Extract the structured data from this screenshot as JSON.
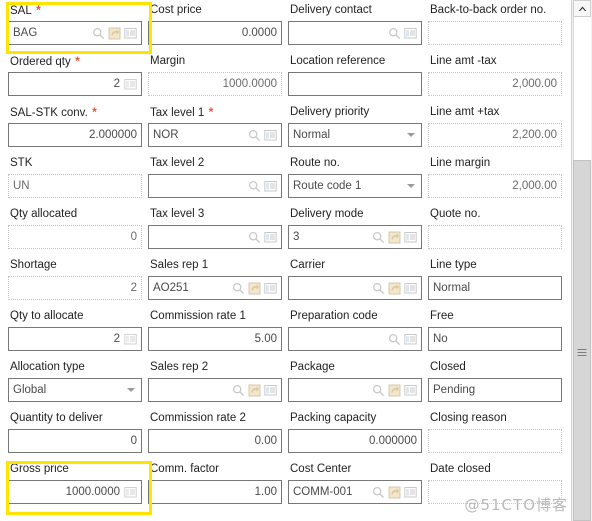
{
  "form": {
    "rows": [
      [
        {
          "label": "SAL",
          "required": true,
          "value": "BAG",
          "align": "left",
          "state": "enabled",
          "type": "lookup",
          "icons": [
            "search-icon",
            "lookup-icon",
            "list-icon"
          ],
          "name": "sal"
        },
        {
          "label": "Cost price",
          "required": false,
          "value": "0.0000",
          "align": "right",
          "state": "enabled",
          "type": "text",
          "icons": [],
          "name": "cost-price"
        },
        {
          "label": "Delivery contact",
          "required": false,
          "value": "",
          "align": "left",
          "state": "enabled",
          "type": "lookup",
          "icons": [
            "search-icon",
            "list-icon"
          ],
          "name": "delivery-contact"
        },
        {
          "label": "Back-to-back order no.",
          "required": false,
          "value": "",
          "align": "left",
          "state": "disabled",
          "type": "text",
          "icons": [],
          "name": "back-to-back-order-no"
        }
      ],
      [
        {
          "label": "Ordered qty",
          "required": true,
          "value": "2",
          "align": "right",
          "state": "enabled",
          "type": "calc",
          "icons": [
            "calculator-icon"
          ],
          "name": "ordered-qty"
        },
        {
          "label": "Margin",
          "required": false,
          "value": "1000.0000",
          "align": "right",
          "state": "disabled",
          "type": "text",
          "icons": [],
          "name": "margin"
        },
        {
          "label": "Location reference",
          "required": false,
          "value": "",
          "align": "left",
          "state": "enabled",
          "type": "text",
          "icons": [],
          "name": "location-reference"
        },
        {
          "label": "Line amt -tax",
          "required": false,
          "value": "2,000.00",
          "align": "right",
          "state": "disabled",
          "type": "text",
          "icons": [],
          "name": "line-amt-minus-tax"
        }
      ],
      [
        {
          "label": "SAL-STK conv.",
          "required": true,
          "value": "2.000000",
          "align": "right",
          "state": "enabled",
          "type": "text",
          "icons": [],
          "name": "sal-stk-conv"
        },
        {
          "label": "Tax level 1",
          "required": true,
          "value": "NOR",
          "align": "left",
          "state": "enabled",
          "type": "lookup",
          "icons": [
            "search-icon",
            "list-icon"
          ],
          "name": "tax-level-1"
        },
        {
          "label": "Delivery priority",
          "required": false,
          "value": "Normal",
          "align": "left",
          "state": "enabled",
          "type": "select",
          "icons": [],
          "name": "delivery-priority"
        },
        {
          "label": "Line amt +tax",
          "required": false,
          "value": "2,200.00",
          "align": "right",
          "state": "disabled",
          "type": "text",
          "icons": [],
          "name": "line-amt-plus-tax"
        }
      ],
      [
        {
          "label": "STK",
          "required": false,
          "value": "UN",
          "align": "left",
          "state": "disabled",
          "type": "text",
          "icons": [],
          "name": "stk"
        },
        {
          "label": "Tax level 2",
          "required": false,
          "value": "",
          "align": "left",
          "state": "enabled",
          "type": "lookup",
          "icons": [
            "search-icon",
            "list-icon"
          ],
          "name": "tax-level-2"
        },
        {
          "label": "Route no.",
          "required": false,
          "value": "Route code 1",
          "align": "left",
          "state": "enabled",
          "type": "select",
          "icons": [],
          "name": "route-no"
        },
        {
          "label": "Line margin",
          "required": false,
          "value": "2,000.00",
          "align": "right",
          "state": "disabled",
          "type": "text",
          "icons": [],
          "name": "line-margin"
        }
      ],
      [
        {
          "label": "Qty allocated",
          "required": false,
          "value": "0",
          "align": "right",
          "state": "disabled",
          "type": "text",
          "icons": [],
          "name": "qty-allocated"
        },
        {
          "label": "Tax level 3",
          "required": false,
          "value": "",
          "align": "left",
          "state": "enabled",
          "type": "lookup",
          "icons": [
            "search-icon",
            "list-icon"
          ],
          "name": "tax-level-3"
        },
        {
          "label": "Delivery mode",
          "required": false,
          "value": "3",
          "align": "left",
          "state": "enabled",
          "type": "lookup",
          "icons": [
            "search-icon",
            "lookup-icon",
            "list-icon"
          ],
          "name": "delivery-mode"
        },
        {
          "label": "Quote no.",
          "required": false,
          "value": "",
          "align": "left",
          "state": "disabled",
          "type": "text",
          "icons": [],
          "name": "quote-no"
        }
      ],
      [
        {
          "label": "Shortage",
          "required": false,
          "value": "2",
          "align": "right",
          "state": "disabled",
          "type": "text",
          "icons": [],
          "name": "shortage"
        },
        {
          "label": "Sales rep 1",
          "required": false,
          "value": "AO251",
          "align": "left",
          "state": "enabled",
          "type": "lookup",
          "icons": [
            "search-icon",
            "lookup-icon",
            "list-icon"
          ],
          "name": "sales-rep-1"
        },
        {
          "label": "Carrier",
          "required": false,
          "value": "",
          "align": "left",
          "state": "enabled",
          "type": "lookup",
          "icons": [
            "search-icon",
            "lookup-icon",
            "list-icon"
          ],
          "name": "carrier"
        },
        {
          "label": "Line type",
          "required": false,
          "value": "Normal",
          "align": "left",
          "state": "enabled",
          "type": "text",
          "icons": [],
          "name": "line-type"
        }
      ],
      [
        {
          "label": "Qty to allocate",
          "required": false,
          "value": "2",
          "align": "right",
          "state": "enabled",
          "type": "calc",
          "icons": [
            "calculator-icon"
          ],
          "name": "qty-to-allocate"
        },
        {
          "label": "Commission rate 1",
          "required": false,
          "value": "5.00",
          "align": "right",
          "state": "enabled",
          "type": "text",
          "icons": [],
          "name": "commission-rate-1"
        },
        {
          "label": "Preparation code",
          "required": false,
          "value": "",
          "align": "left",
          "state": "enabled",
          "type": "lookup",
          "icons": [
            "search-icon",
            "list-icon"
          ],
          "name": "preparation-code"
        },
        {
          "label": "Free",
          "required": false,
          "value": "No",
          "align": "left",
          "state": "enabled",
          "type": "text",
          "icons": [],
          "name": "free"
        }
      ],
      [
        {
          "label": "Allocation type",
          "required": false,
          "value": "Global",
          "align": "left",
          "state": "enabled",
          "type": "select",
          "icons": [],
          "name": "allocation-type"
        },
        {
          "label": "Sales rep 2",
          "required": false,
          "value": "",
          "align": "left",
          "state": "enabled",
          "type": "lookup",
          "icons": [
            "search-icon",
            "lookup-icon",
            "list-icon"
          ],
          "name": "sales-rep-2"
        },
        {
          "label": "Package",
          "required": false,
          "value": "",
          "align": "left",
          "state": "enabled",
          "type": "lookup",
          "icons": [
            "search-icon",
            "lookup-icon",
            "list-icon"
          ],
          "name": "package"
        },
        {
          "label": "Closed",
          "required": false,
          "value": "Pending",
          "align": "left",
          "state": "enabled",
          "type": "text",
          "icons": [],
          "name": "closed"
        }
      ],
      [
        {
          "label": "Quantity to deliver",
          "required": false,
          "value": "0",
          "align": "right",
          "state": "enabled",
          "type": "text",
          "icons": [],
          "name": "quantity-to-deliver"
        },
        {
          "label": "Commission rate 2",
          "required": false,
          "value": "0.00",
          "align": "right",
          "state": "enabled",
          "type": "text",
          "icons": [],
          "name": "commission-rate-2"
        },
        {
          "label": "Packing capacity",
          "required": false,
          "value": "0.000000",
          "align": "right",
          "state": "enabled",
          "type": "text",
          "icons": [],
          "name": "packing-capacity"
        },
        {
          "label": "Closing reason",
          "required": false,
          "value": "",
          "align": "left",
          "state": "disabled",
          "type": "text",
          "icons": [],
          "name": "closing-reason"
        }
      ],
      [
        {
          "label": "Gross price",
          "required": false,
          "value": "1000.0000",
          "align": "right",
          "state": "enabled",
          "type": "calc",
          "icons": [
            "calculator-icon"
          ],
          "name": "gross-price"
        },
        {
          "label": "Comm. factor",
          "required": false,
          "value": "1.00",
          "align": "right",
          "state": "enabled",
          "type": "text",
          "icons": [],
          "name": "comm-factor"
        },
        {
          "label": "Cost Center",
          "required": false,
          "value": "COMM-001",
          "align": "left",
          "state": "enabled",
          "type": "lookup",
          "icons": [
            "search-icon",
            "lookup-icon",
            "list-icon"
          ],
          "name": "cost-center"
        },
        {
          "label": "Date closed",
          "required": false,
          "value": "",
          "align": "left",
          "state": "disabled",
          "type": "text",
          "icons": [],
          "name": "date-closed"
        }
      ]
    ],
    "highlighted_fields": [
      "sal",
      "gross-price"
    ],
    "highlight_color": "#ffe400",
    "required_marker": "*",
    "required_color": "#e8543f"
  },
  "scrollbar": {
    "up_arrow": "chevron-up-icon",
    "grip": "grip-icon"
  },
  "watermark": {
    "text": "@51CTO博客"
  }
}
